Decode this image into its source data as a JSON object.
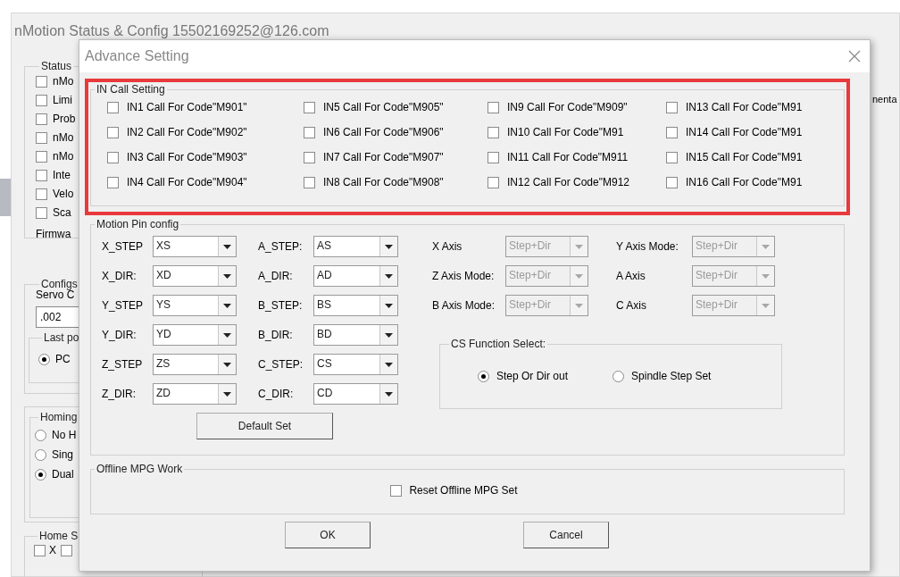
{
  "background_window": {
    "title": "nMotion Status & Config 15502169252@126.com",
    "status": {
      "label": "Status",
      "items": [
        {
          "label": "nMo",
          "checked": false
        },
        {
          "label": "Limi",
          "checked": false
        },
        {
          "label": "Prob",
          "checked": false
        },
        {
          "label": "nMo",
          "checked": false
        },
        {
          "label": "nMo",
          "checked": false
        },
        {
          "label": "Inte",
          "checked": false
        },
        {
          "label": "Velo",
          "checked": false
        },
        {
          "label": "Sca",
          "checked": false
        }
      ],
      "firmware_label": "Firmwa"
    },
    "configs": {
      "label": "Configs",
      "servo_label": "Servo C",
      "servo_value": ".002",
      "last_position": {
        "label": "Last po",
        "options": [
          {
            "label": "PC",
            "selected": true
          }
        ]
      }
    },
    "homing": {
      "label": "Homing",
      "options": [
        {
          "label": "No H",
          "selected": false
        },
        {
          "label": "Sing",
          "selected": false
        },
        {
          "label": "Dual",
          "selected": true
        }
      ]
    },
    "home_switch": {
      "label": "Home S",
      "items": [
        {
          "label": "X",
          "checked": false
        },
        {
          "checked": false
        }
      ]
    },
    "right_text": "nenta"
  },
  "dialog": {
    "title": "Advance Setting",
    "highlighted": true,
    "in_call": {
      "label": "IN Call Setting",
      "columns": [
        {
          "items": [
            {
              "label": "IN1 Call For Code\"M901\"",
              "checked": false
            },
            {
              "label": "IN2 Call For Code\"M902\"",
              "checked": false
            },
            {
              "label": "IN3 Call For Code\"M903\"",
              "checked": false
            },
            {
              "label": "IN4 Call For Code\"M904\"",
              "checked": false
            }
          ]
        },
        {
          "items": [
            {
              "label": "IN5 Call For Code\"M905\"",
              "checked": false
            },
            {
              "label": "IN6 Call For Code\"M906\"",
              "checked": false
            },
            {
              "label": "IN7 Call For Code\"M907\"",
              "checked": false
            },
            {
              "label": "IN8 Call For Code\"M908\"",
              "checked": false
            }
          ]
        },
        {
          "items": [
            {
              "label": "IN9 Call For Code\"M909\"",
              "checked": false
            },
            {
              "label": "IN10 Call For Code\"M91",
              "checked": false
            },
            {
              "label": "IN11 Call For Code\"M911",
              "checked": false
            },
            {
              "label": "IN12 Call For Code\"M912",
              "checked": false
            }
          ]
        },
        {
          "items": [
            {
              "label": "IN13 Call For Code\"M91",
              "checked": false
            },
            {
              "label": "IN14 Call For Code\"M91",
              "checked": false
            },
            {
              "label": "IN15 Call For Code\"M91",
              "checked": false
            },
            {
              "label": "IN16 Call For Code\"M91",
              "checked": false
            }
          ]
        }
      ]
    },
    "motion_pin": {
      "label": "Motion Pin config",
      "pin_columns": [
        {
          "pins": [
            {
              "label": "X_STEP",
              "value": "XS"
            },
            {
              "label": "X_DIR:",
              "value": "XD"
            },
            {
              "label": "Y_STEP",
              "value": "YS"
            },
            {
              "label": "Y_DIR:",
              "value": "YD"
            },
            {
              "label": "Z_STEP",
              "value": "ZS"
            },
            {
              "label": "Z_DIR:",
              "value": "ZD"
            }
          ]
        },
        {
          "pins": [
            {
              "label": "A_STEP:",
              "value": "AS"
            },
            {
              "label": "A_DIR:",
              "value": "AD"
            },
            {
              "label": "B_STEP:",
              "value": "BS"
            },
            {
              "label": "B_DIR:",
              "value": "BD"
            },
            {
              "label": "C_STEP:",
              "value": "CS"
            },
            {
              "label": "C_DIR:",
              "value": "CD"
            }
          ]
        }
      ],
      "axis_modes": [
        {
          "label": "X Axis",
          "value": "Step+Dir",
          "disabled": true
        },
        {
          "label": "Y Axis Mode:",
          "value": "Step+Dir",
          "disabled": true
        },
        {
          "label": "Z Axis Mode:",
          "value": "Step+Dir",
          "disabled": true
        },
        {
          "label": "A Axis",
          "value": "Step+Dir",
          "disabled": true
        },
        {
          "label": "B Axis Mode:",
          "value": "Step+Dir",
          "disabled": true
        },
        {
          "label": "C Axis",
          "value": "Step+Dir",
          "disabled": true
        }
      ],
      "cs_function": {
        "label": "CS Function Select:",
        "options": [
          {
            "label": "Step Or Dir out",
            "selected": true
          },
          {
            "label": "Spindle Step Set",
            "selected": false
          }
        ]
      },
      "default_button": "Default Set"
    },
    "offline_mpg": {
      "label": "Offline MPG Work",
      "reset": {
        "label": "Reset Offline MPG Set",
        "checked": false
      }
    },
    "buttons": [
      "OK",
      "Cancel"
    ]
  }
}
